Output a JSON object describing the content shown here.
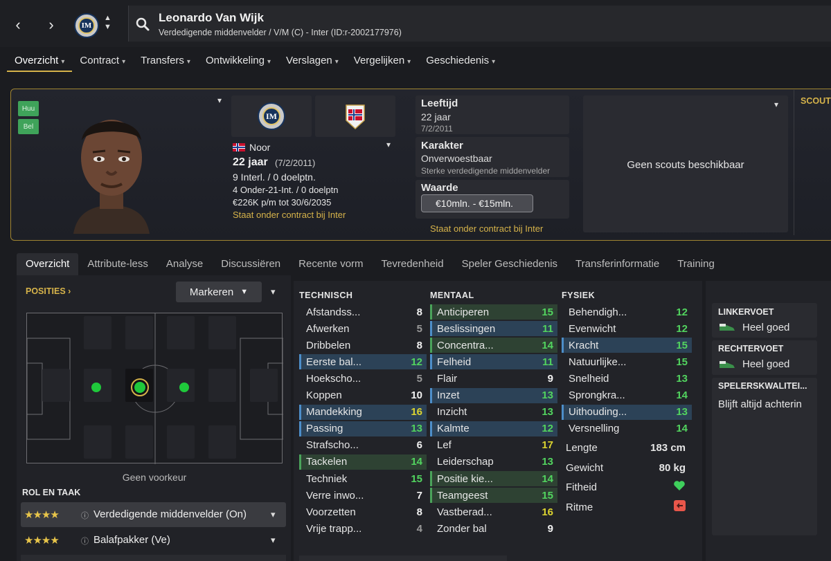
{
  "nav": {
    "back_icon": "‹",
    "forward_icon": "›"
  },
  "player": {
    "name": "Leonardo Van Wijk",
    "subtitle": "Verdedigende middenvelder / V/M (C) - Inter (ID:r-2002177976)"
  },
  "main_tabs": [
    "Overzicht",
    "Contract",
    "Transfers",
    "Ontwikkeling",
    "Verslagen",
    "Vergelijken",
    "Geschiedenis"
  ],
  "side_tags": [
    "Huu",
    "Bel"
  ],
  "profile": {
    "nationality": "Noor",
    "age": "22 jaar",
    "dob": "(7/2/2011)",
    "caps": "9 Interl. / 0 doelptn.",
    "u21": "4 Onder-21-Int. / 0 doelptn",
    "wage": "€226K p/m tot 30/6/2035",
    "contract": "Staat onder contract bij Inter"
  },
  "facts": {
    "age_label": "Leeftijd",
    "age_value": "22 jaar",
    "age_date": "7/2/2011",
    "char_label": "Karakter",
    "char_value": "Onverwoestbaar",
    "char_sub": "Sterke verdedigende middenvelder",
    "value_label": "Waarde",
    "value_range": "€10mln. - €15mln.",
    "contract_note": "Staat onder contract bij Inter"
  },
  "scouts": {
    "empty": "Geen scouts beschikbaar",
    "header": "SCOUT"
  },
  "sub_tabs": [
    "Overzicht",
    "Attribute-less",
    "Analyse",
    "Discussiëren",
    "Recente vorm",
    "Tevredenheid",
    "Speler Geschiedenis",
    "Transferinformatie",
    "Training"
  ],
  "positions": {
    "header": "POSITIES",
    "mark_button": "Markeren",
    "no_pref": "Geen voorkeur"
  },
  "roles": {
    "header": "ROL EN TAAK",
    "items": [
      {
        "stars": "★★★★",
        "label": "Verdedigende middenvelder (On)"
      },
      {
        "stars": "★★★★",
        "label": "Balafpakker (Ve)"
      }
    ]
  },
  "attributes": {
    "technisch": {
      "header": "TECHNISCH",
      "rows": [
        {
          "label": "Afstandss...",
          "value": "8",
          "tone": "white",
          "hl": ""
        },
        {
          "label": "Afwerken",
          "value": "5",
          "tone": "grey",
          "hl": ""
        },
        {
          "label": "Dribbelen",
          "value": "8",
          "tone": "white",
          "hl": ""
        },
        {
          "label": "Eerste bal...",
          "value": "12",
          "tone": "green",
          "hl": "blue"
        },
        {
          "label": "Hoekscho...",
          "value": "5",
          "tone": "grey",
          "hl": ""
        },
        {
          "label": "Koppen",
          "value": "10",
          "tone": "white",
          "hl": ""
        },
        {
          "label": "Mandekking",
          "value": "16",
          "tone": "yellow",
          "hl": "blue"
        },
        {
          "label": "Passing",
          "value": "13",
          "tone": "green",
          "hl": "blue"
        },
        {
          "label": "Strafscho...",
          "value": "6",
          "tone": "white",
          "hl": ""
        },
        {
          "label": "Tackelen",
          "value": "14",
          "tone": "green",
          "hl": "green"
        },
        {
          "label": "Techniek",
          "value": "15",
          "tone": "green",
          "hl": ""
        },
        {
          "label": "Verre inwo...",
          "value": "7",
          "tone": "white",
          "hl": ""
        },
        {
          "label": "Voorzetten",
          "value": "8",
          "tone": "white",
          "hl": ""
        },
        {
          "label": "Vrije trapp...",
          "value": "4",
          "tone": "grey",
          "hl": ""
        }
      ]
    },
    "mentaal": {
      "header": "MENTAAL",
      "rows": [
        {
          "label": "Anticiperen",
          "value": "15",
          "tone": "green",
          "hl": "green"
        },
        {
          "label": "Beslissingen",
          "value": "11",
          "tone": "green",
          "hl": "blue"
        },
        {
          "label": "Concentra...",
          "value": "14",
          "tone": "green",
          "hl": "green"
        },
        {
          "label": "Felheid",
          "value": "11",
          "tone": "green",
          "hl": "blue"
        },
        {
          "label": "Flair",
          "value": "9",
          "tone": "white",
          "hl": ""
        },
        {
          "label": "Inzet",
          "value": "13",
          "tone": "green",
          "hl": "blue"
        },
        {
          "label": "Inzicht",
          "value": "13",
          "tone": "green",
          "hl": ""
        },
        {
          "label": "Kalmte",
          "value": "12",
          "tone": "green",
          "hl": "blue"
        },
        {
          "label": "Lef",
          "value": "17",
          "tone": "yellow",
          "hl": ""
        },
        {
          "label": "Leiderschap",
          "value": "13",
          "tone": "green",
          "hl": ""
        },
        {
          "label": "Positie kie...",
          "value": "14",
          "tone": "green",
          "hl": "green"
        },
        {
          "label": "Teamgeest",
          "value": "15",
          "tone": "green",
          "hl": "green"
        },
        {
          "label": "Vastberad...",
          "value": "16",
          "tone": "yellow",
          "hl": ""
        },
        {
          "label": "Zonder bal",
          "value": "9",
          "tone": "white",
          "hl": ""
        }
      ]
    },
    "fysiek": {
      "header": "FYSIEK",
      "rows": [
        {
          "label": "Behendigh...",
          "value": "12",
          "tone": "green",
          "hl": ""
        },
        {
          "label": "Evenwicht",
          "value": "12",
          "tone": "green",
          "hl": ""
        },
        {
          "label": "Kracht",
          "value": "15",
          "tone": "green",
          "hl": "blue"
        },
        {
          "label": "Natuurlijke...",
          "value": "15",
          "tone": "green",
          "hl": ""
        },
        {
          "label": "Snelheid",
          "value": "13",
          "tone": "green",
          "hl": ""
        },
        {
          "label": "Sprongkra...",
          "value": "14",
          "tone": "green",
          "hl": ""
        },
        {
          "label": "Uithouding...",
          "value": "13",
          "tone": "green",
          "hl": "blue"
        },
        {
          "label": "Versnelling",
          "value": "14",
          "tone": "green",
          "hl": ""
        }
      ]
    },
    "extra": [
      {
        "label": "Lengte",
        "value": "183 cm"
      },
      {
        "label": "Gewicht",
        "value": "80 kg"
      },
      {
        "label": "Fitheid",
        "icon": "heart-icon"
      },
      {
        "label": "Ritme",
        "icon": "rhythm-icon"
      }
    ]
  },
  "feet": {
    "left_header": "LINKERVOET",
    "left_value": "Heel goed",
    "right_header": "RECHTERVOET",
    "right_value": "Heel goed",
    "qualities_header": "SPELERSKWALITEI...",
    "qualities_value": "Blijft altijd achterin"
  },
  "colors": {
    "accent": "#d6b34a",
    "green": "#52d45f",
    "yellow": "#dcd430",
    "blue_hl": "#2c4257"
  }
}
